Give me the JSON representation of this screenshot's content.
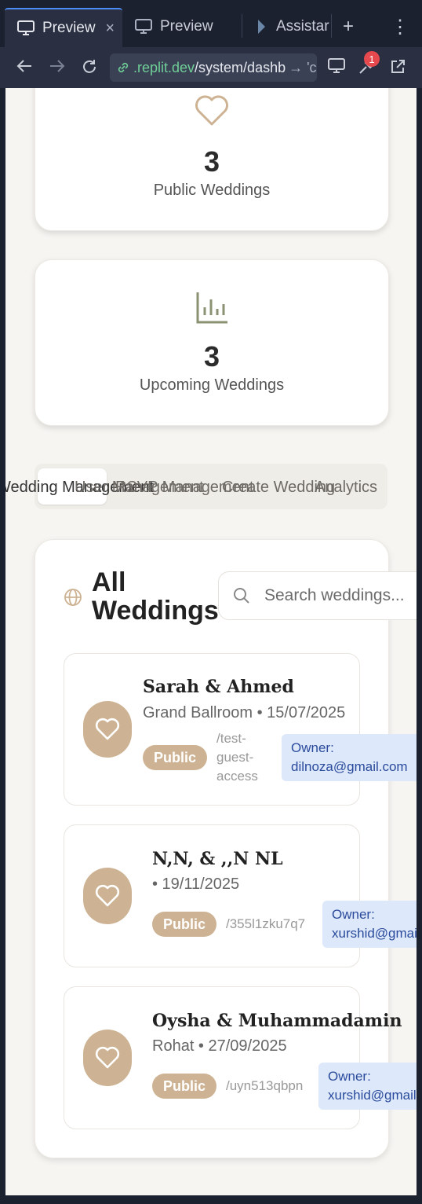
{
  "browser": {
    "tabs": [
      {
        "label": "Preview",
        "active": true
      },
      {
        "label": "Preview",
        "active": false
      },
      {
        "label": "Assistar",
        "active": false
      }
    ],
    "close_glyph": "×",
    "new_tab_glyph": "+",
    "menu_glyph": "⋮",
    "url_domain": ".replit.dev",
    "url_path": "/system/dashb",
    "url_tail": "→ 'c",
    "notification_count": "1"
  },
  "stats": [
    {
      "icon": "heart-icon",
      "value": "3",
      "label": "Public Weddings"
    },
    {
      "icon": "bar-chart-icon",
      "value": "3",
      "label": "Upcoming Weddings"
    }
  ],
  "nav_tabs": [
    "Wedding Management",
    "User Management",
    "RSVP Management",
    "Create Wedding",
    "Analytics"
  ],
  "all_weddings": {
    "title_line1": "All",
    "title_line2": "Weddings",
    "search_placeholder": "Search weddings..."
  },
  "weddings": [
    {
      "name": "Sarah & Ahmed",
      "subtitle": "Grand Ballroom • 15/07/2025",
      "status": "Public",
      "slug": "/test-guest-access",
      "owner_label": "Owner:",
      "owner": "dilnoza@gmail.com"
    },
    {
      "name": "N,N, & ,,N NL",
      "subtitle": "• 19/11/2025",
      "status": "Public",
      "slug": "/355l1zku7q7",
      "owner_label": "Owner:",
      "owner": "xurshid@gmail.com"
    },
    {
      "name": "Oysha & Muhammadamin",
      "subtitle": "Rohat • 27/09/2025",
      "status": "Public",
      "slug": "/uyn513qbpn",
      "owner_label": "Owner:",
      "owner": "xurshid@gmail.com"
    }
  ],
  "colors": {
    "accent": "#cdb393",
    "chart_icon": "#8a9273",
    "owner_bg": "#dde8fb"
  }
}
